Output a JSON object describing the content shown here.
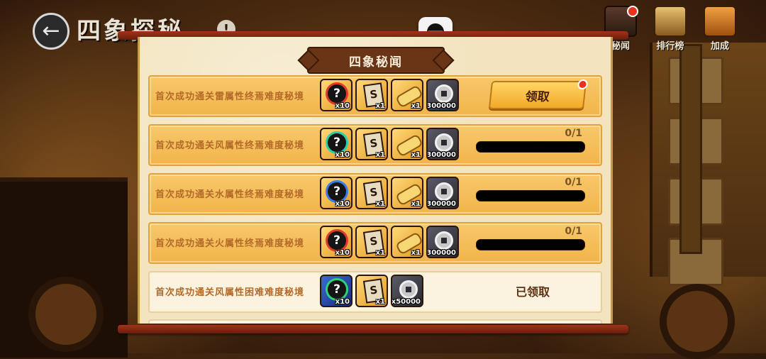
{
  "page": {
    "title": "四象探秘",
    "back_icon": "arrow-left-icon",
    "info_icon": "info-icon",
    "info_glyph": "!"
  },
  "top_menu": [
    {
      "label": "秘闻",
      "icon": "scroll-book-icon",
      "has_red_dot": true
    },
    {
      "label": "排行榜",
      "icon": "ranking-icon",
      "has_red_dot": false
    },
    {
      "label": "加成",
      "icon": "bonus-arrow-icon",
      "has_red_dot": false
    }
  ],
  "qq_icon": "qq-penguin-icon",
  "panel": {
    "title": "四象秘闻"
  },
  "rows": [
    {
      "title": "首次成功通关雷属性终焉难度秘境",
      "rewards": [
        {
          "type": "mystery-orb",
          "ring": "red",
          "qty": "x10",
          "bg": "gold"
        },
        {
          "type": "paper-note",
          "qty": "x1",
          "bg": "gold"
        },
        {
          "type": "golden-scroll",
          "qty": "x1",
          "bg": "gold"
        },
        {
          "type": "coin",
          "qty": "x300000",
          "bg": "dark"
        }
      ],
      "state": "claimable",
      "button_label": "领取"
    },
    {
      "title": "首次成功通关风属性终焉难度秘境",
      "rewards": [
        {
          "type": "mystery-orb",
          "ring": "teal",
          "qty": "x10",
          "bg": "gold"
        },
        {
          "type": "paper-note",
          "qty": "x1",
          "bg": "gold"
        },
        {
          "type": "golden-scroll",
          "qty": "x1",
          "bg": "gold"
        },
        {
          "type": "coin",
          "qty": "x300000",
          "bg": "dark"
        }
      ],
      "state": "in_progress",
      "progress_text": "0/1",
      "progress": 0
    },
    {
      "title": "首次成功通关水属性终焉难度秘境",
      "rewards": [
        {
          "type": "mystery-orb",
          "ring": "blue",
          "qty": "x10",
          "bg": "gold"
        },
        {
          "type": "paper-note",
          "qty": "x1",
          "bg": "gold"
        },
        {
          "type": "golden-scroll",
          "qty": "x1",
          "bg": "gold"
        },
        {
          "type": "coin",
          "qty": "x300000",
          "bg": "dark"
        }
      ],
      "state": "in_progress",
      "progress_text": "0/1",
      "progress": 0
    },
    {
      "title": "首次成功通关火属性终焉难度秘境",
      "rewards": [
        {
          "type": "mystery-orb",
          "ring": "red",
          "qty": "x10",
          "bg": "gold"
        },
        {
          "type": "paper-note",
          "qty": "x1",
          "bg": "gold"
        },
        {
          "type": "golden-scroll",
          "qty": "x1",
          "bg": "gold"
        },
        {
          "type": "coin",
          "qty": "x300000",
          "bg": "dark"
        }
      ],
      "state": "in_progress",
      "progress_text": "0/1",
      "progress": 0
    },
    {
      "title": "首次成功通关风属性困难难度秘境",
      "rewards": [
        {
          "type": "mystery-orb",
          "ring": "green",
          "qty": "x10",
          "bg": "blue"
        },
        {
          "type": "paper-note",
          "qty": "x1",
          "bg": "gold"
        },
        {
          "type": "coin",
          "qty": "x50000",
          "bg": "dark"
        }
      ],
      "state": "claimed",
      "status_text": "已领取"
    }
  ],
  "colors": {
    "accent_gold": "#f2b44c",
    "panel_bg": "#f3e4bf",
    "title_text": "#b36a28",
    "rod": "#a0341a"
  }
}
